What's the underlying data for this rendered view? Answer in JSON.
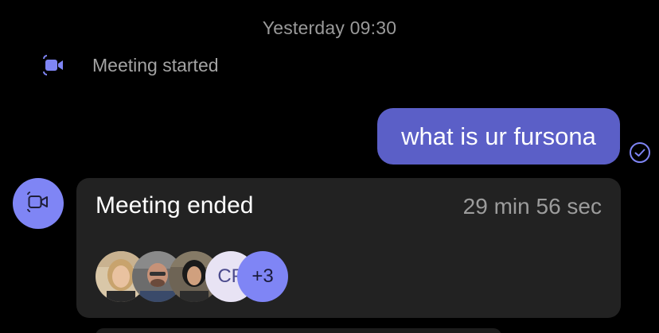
{
  "timestamp": "Yesterday 09:30",
  "meeting_started": {
    "icon": "video-camera-icon",
    "label": "Meeting started"
  },
  "outgoing_message": {
    "text": "what is ur fursona",
    "status_icon": "read-check-icon"
  },
  "meeting_card": {
    "icon": "video-call-icon",
    "title": "Meeting ended",
    "duration": "29 min 56 sec",
    "participants": [
      {
        "type": "photo",
        "name": "participant-1"
      },
      {
        "type": "photo",
        "name": "participant-2"
      },
      {
        "type": "photo",
        "name": "participant-3"
      },
      {
        "type": "initials",
        "initials": "CP"
      },
      {
        "type": "more",
        "label": "+3"
      }
    ]
  },
  "colors": {
    "background": "#000000",
    "accent": "#5b5fc7",
    "accent_light": "#7f85f5",
    "card": "#222222",
    "muted_text": "#9a9a9a"
  }
}
